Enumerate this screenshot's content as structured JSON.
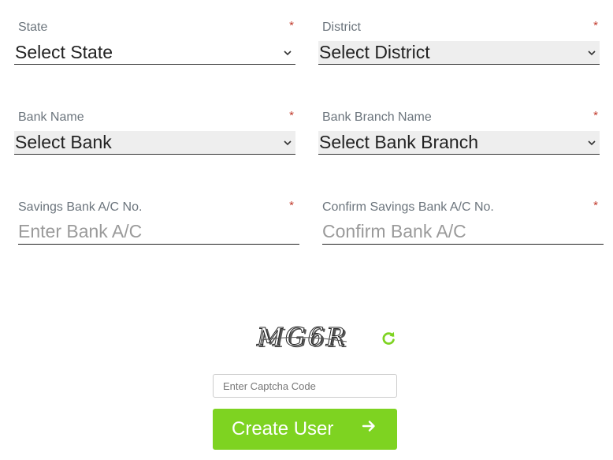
{
  "form": {
    "state": {
      "label": "State",
      "required": "*",
      "value": "Select State"
    },
    "district": {
      "label": "District",
      "required": "*",
      "value": "Select District"
    },
    "bank_name": {
      "label": "Bank Name",
      "required": "*",
      "value": "Select Bank"
    },
    "bank_branch": {
      "label": "Bank Branch Name",
      "required": "*",
      "value": "Select Bank Branch"
    },
    "account_no": {
      "label": "Savings Bank A/C No.",
      "required": "*",
      "placeholder": "Enter Bank A/C"
    },
    "confirm_account_no": {
      "label": "Confirm Savings Bank A/C No.",
      "required": "*",
      "placeholder": "Confirm Bank A/C"
    }
  },
  "captcha": {
    "text": "MG6R",
    "refresh_icon": "refresh-icon",
    "input_placeholder": "Enter Captcha Code"
  },
  "submit": {
    "label": "Create User",
    "icon": "arrow-right-icon"
  },
  "colors": {
    "accent": "#7ed321",
    "required": "#c0392b",
    "select_bg": "#eeeeee"
  }
}
